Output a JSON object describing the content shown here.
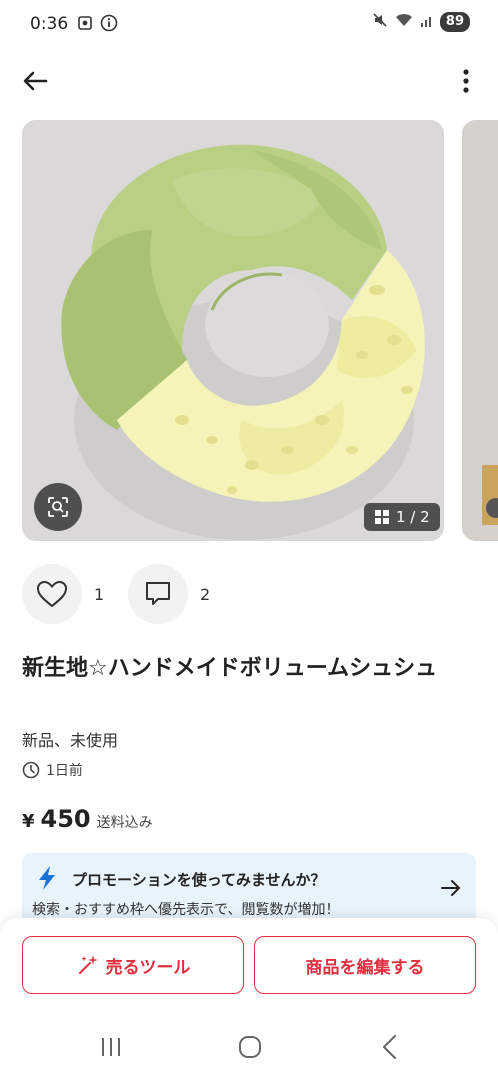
{
  "status_bar": {
    "time": "0:36",
    "battery": "89",
    "icons": [
      "screenshot-icon",
      "info-icon",
      "mute-icon",
      "wifi-icon",
      "signal-icon",
      "battery-icon"
    ]
  },
  "header": {
    "back_icon": "back-arrow-icon",
    "more_icon": "more-vert-icon"
  },
  "gallery": {
    "counter": "1 / 2",
    "lens_icon": "visual-search-icon",
    "counter_icon": "grid-icon"
  },
  "social": {
    "likes": "1",
    "comments": "2"
  },
  "item": {
    "title": "新生地☆ハンドメイドボリュームシュシュ",
    "condition": "新品、未使用",
    "posted": "1日前",
    "currency": "¥",
    "price": "450",
    "shipping": "送料込み"
  },
  "promo": {
    "title": "プロモーションを使ってみませんか？",
    "subtitle": "検索・おすすめ枠へ優先表示で、閲覧数が増加！"
  },
  "actions": {
    "sell_tool": "売るツール",
    "edit_item": "商品を編集する"
  },
  "colors": {
    "accent": "#e0303f",
    "promo_bg": "#e8f3fc",
    "promo_icon": "#1a73d9"
  }
}
